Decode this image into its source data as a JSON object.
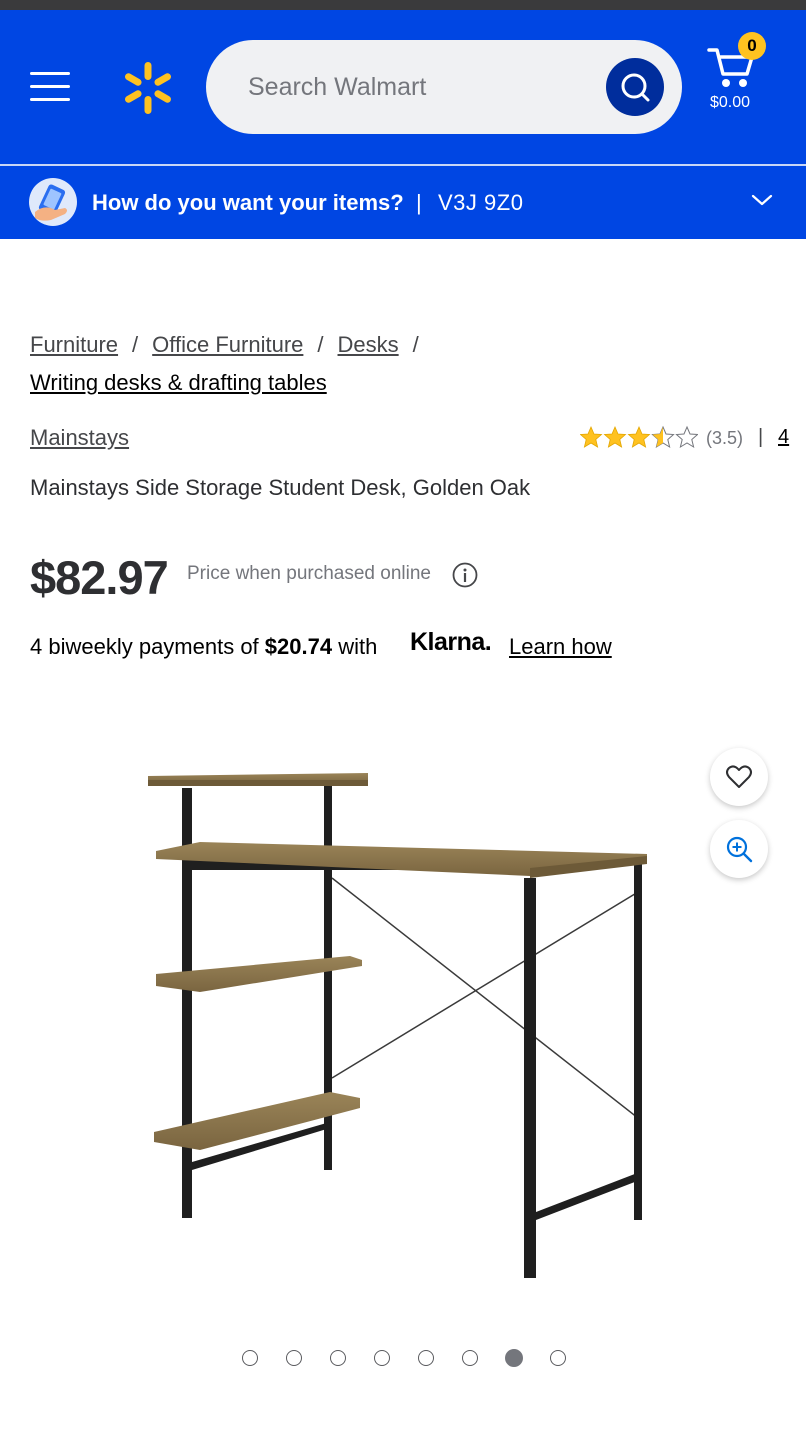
{
  "header": {
    "search_placeholder": "Search Walmart",
    "cart_count": "0",
    "cart_total": "$0.00",
    "brand_color": "#0046e3",
    "spark_color": "#ffc220"
  },
  "delivery": {
    "question": "How do you want your items?",
    "separator": "|",
    "postal_code": "V3J 9Z0"
  },
  "breadcrumb": {
    "items": [
      "Furniture",
      "Office Furniture",
      "Desks"
    ],
    "separator": "/",
    "current": "Writing desks & drafting tables"
  },
  "product": {
    "brand": "Mainstays",
    "rating": 3.5,
    "rating_text": "(3.5)",
    "rating_separator": "|",
    "review_count": "4",
    "title": "Mainstays Side Storage Student Desk, Golden Oak",
    "price": "$82.97",
    "price_note": "Price when purchased online"
  },
  "financing": {
    "text_before": "4 biweekly payments of ",
    "amount": "$20.74",
    "text_after": " with",
    "provider": "Klarna.",
    "link": "Learn how"
  },
  "gallery": {
    "image_count": 8,
    "active_index": 6
  },
  "icons": [
    "menu-icon",
    "walmart-spark-icon",
    "search-icon",
    "cart-icon",
    "delivery-hand-icon",
    "chevron-down-icon",
    "star-icon",
    "info-icon",
    "heart-icon",
    "zoom-in-icon"
  ]
}
